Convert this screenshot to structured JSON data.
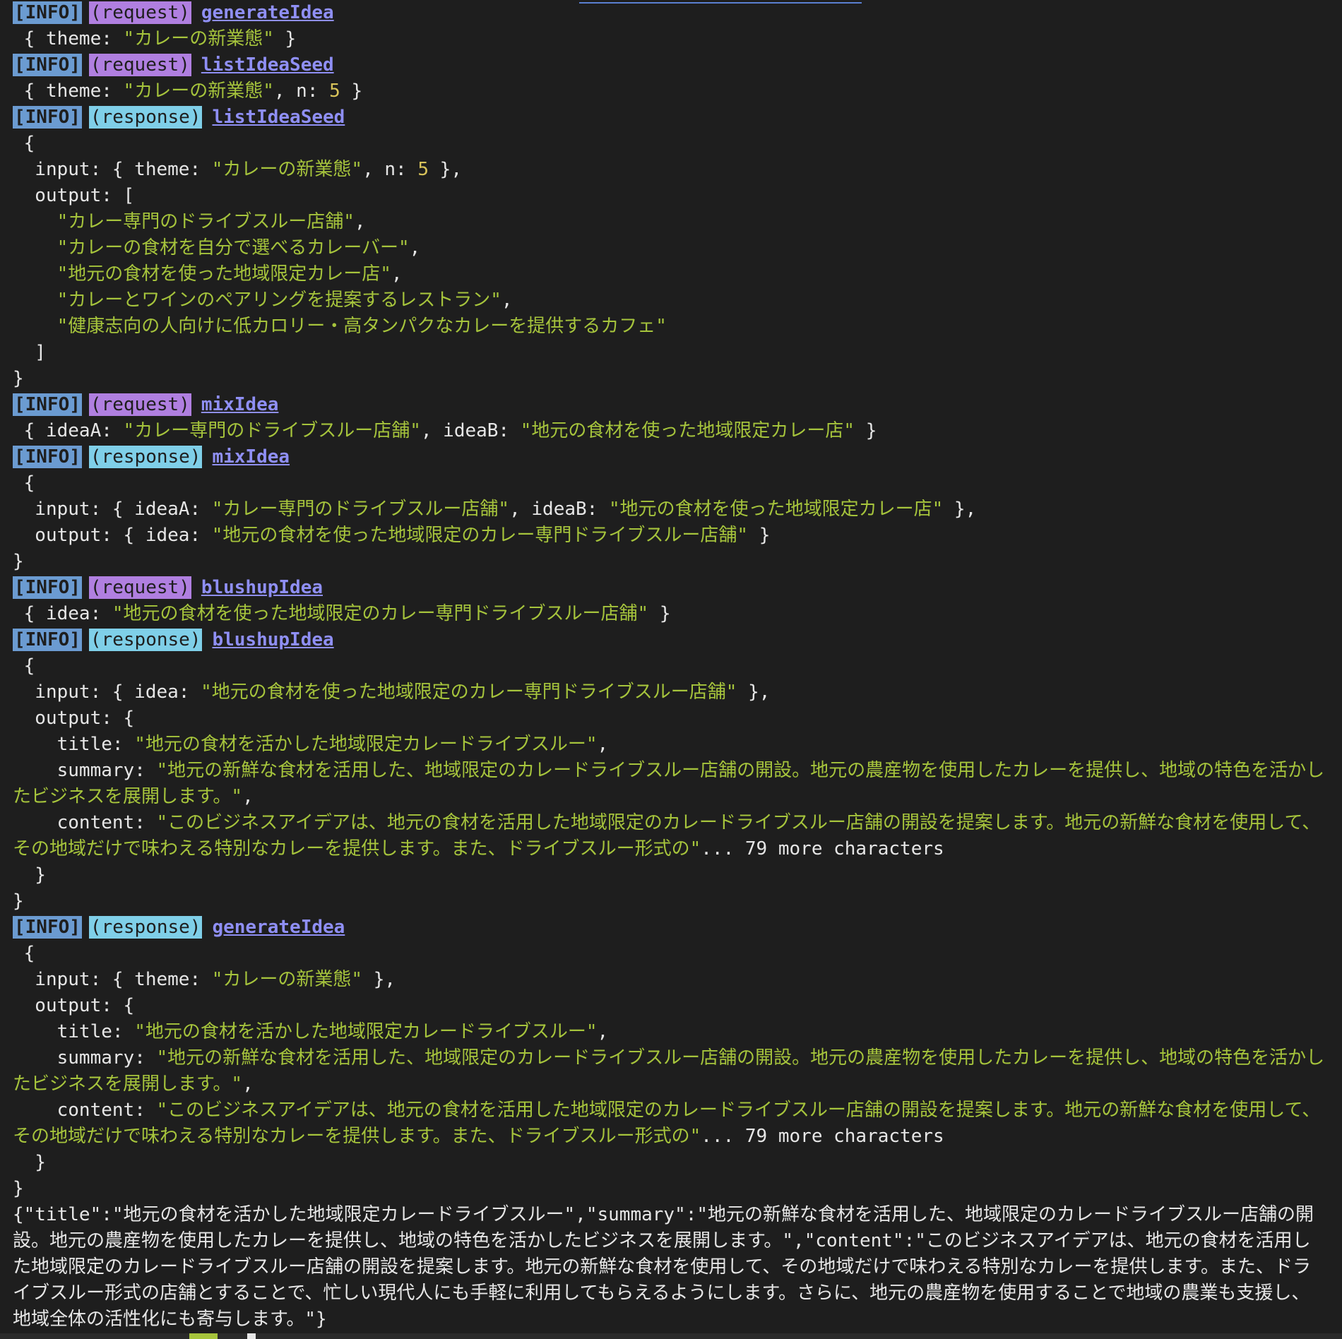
{
  "colors": {
    "background": "#1e1e1e",
    "info_tag": "#6b9bd1",
    "request_tag": "#b07fe0",
    "response_tag": "#7fcfe8",
    "function_name": "#8f8ff5",
    "string": "#a6c43c",
    "number": "#d8c35a"
  },
  "tags": {
    "info": "[INFO]",
    "request": "(request)",
    "response": "(response)"
  },
  "log": {
    "l1_fn": "generateIdea",
    "l2_a": " { theme: ",
    "l2_s": "\"カレーの新業態\"",
    "l2_b": " }",
    "l3_fn": "listIdeaSeed",
    "l4_a": " { theme: ",
    "l4_s": "\"カレーの新業態\"",
    "l4_b": ", n: ",
    "l4_n": "5",
    "l4_c": " }",
    "l5_fn": "listIdeaSeed",
    "l6": " {",
    "l7_a": "  input: { theme: ",
    "l7_s": "\"カレーの新業態\"",
    "l7_b": ", n: ",
    "l7_n": "5",
    "l7_c": " },",
    "l8": "  output: [",
    "l9_s": "    \"カレー専門のドライブスルー店舗\"",
    "l9_b": ",",
    "l10_s": "    \"カレーの食材を自分で選べるカレーバー\"",
    "l10_b": ",",
    "l11_s": "    \"地元の食材を使った地域限定カレー店\"",
    "l11_b": ",",
    "l12_s": "    \"カレーとワインのペアリングを提案するレストラン\"",
    "l12_b": ",",
    "l13_s": "    \"健康志向の人向けに低カロリー・高タンパクなカレーを提供するカフェ\"",
    "l14": "  ]",
    "l15": "}",
    "l16_fn": "mixIdea",
    "l17_a": " { ideaA: ",
    "l17_s1": "\"カレー専門のドライブスルー店舗\"",
    "l17_b": ", ideaB: ",
    "l17_s2": "\"地元の食材を使った地域限定カレー店\"",
    "l17_c": " }",
    "l18_fn": "mixIdea",
    "l19": " {",
    "l20_a": "  input: { ideaA: ",
    "l20_s1": "\"カレー専門のドライブスルー店舗\"",
    "l20_b": ", ideaB: ",
    "l20_s2": "\"地元の食材を使った地域限定カレー店\"",
    "l20_c": " },",
    "l21_a": "  output: { idea: ",
    "l21_s": "\"地元の食材を使った地域限定のカレー専門ドライブスルー店舗\"",
    "l21_c": " }",
    "l22": "}",
    "l23_fn": "blushupIdea",
    "l24_a": " { idea: ",
    "l24_s": "\"地元の食材を使った地域限定のカレー専門ドライブスルー店舗\"",
    "l24_c": " }",
    "l25_fn": "blushupIdea",
    "l26": " {",
    "l27_a": "  input: { idea: ",
    "l27_s": "\"地元の食材を使った地域限定のカレー専門ドライブスルー店舗\"",
    "l27_c": " },",
    "l28": "  output: {",
    "l29_a": "    title: ",
    "l29_s": "\"地元の食材を活かした地域限定カレードライブスルー\"",
    "l29_c": ",",
    "l30_a": "    summary: ",
    "l30_s": "\"地元の新鮮な食材を活用した、地域限定のカレードライブスルー店舗の開設。地元の農産物を使用したカレーを提供し、地域の特色を活かしたビジネスを展開します。\"",
    "l30_c": ",",
    "l31_a": "    content: ",
    "l31_s": "\"このビジネスアイデアは、地元の食材を活用した地域限定のカレードライブスルー店舗の開設を提案します。地元の新鮮な食材を使用して、その地域だけで味わえる特別なカレーを提供します。また、ドライブスルー形式の\"",
    "l31_c": "... 79 more characters",
    "l32": "  }",
    "l33": "}",
    "l34_fn": "generateIdea",
    "l35": " {",
    "l36_a": "  input: { theme: ",
    "l36_s": "\"カレーの新業態\"",
    "l36_c": " },",
    "l37": "  output: {",
    "l38_a": "    title: ",
    "l38_s": "\"地元の食材を活かした地域限定カレードライブスルー\"",
    "l38_c": ",",
    "l39_a": "    summary: ",
    "l39_s": "\"地元の新鮮な食材を活用した、地域限定のカレードライブスルー店舗の開設。地元の農産物を使用したカレーを提供し、地域の特色を活かしたビジネスを展開します。\"",
    "l39_c": ",",
    "l40_a": "    content: ",
    "l40_s": "\"このビジネスアイデアは、地元の食材を活用した地域限定のカレードライブスルー店舗の開設を提案します。地元の新鮮な食材を使用して、その地域だけで味わえる特別なカレーを提供します。また、ドライブスルー形式の\"",
    "l40_c": "... 79 more characters",
    "l41": "  }",
    "l42": "}",
    "l43": "{\"title\":\"地元の食材を活かした地域限定カレードライブスルー\",\"summary\":\"地元の新鮮な食材を活用した、地域限定のカレードライブスルー店舗の開設。地元の農産物を使用したカレーを提供し、地域の特色を活かしたビジネスを展開します。\",\"content\":\"このビジネスアイデアは、地元の食材を活用した地域限定のカレードライブスルー店舗の開設を提案します。地元の新鮮な食材を使用して、その地域だけで味わえる特別なカレーを提供します。また、ドライブスルー形式の店舗とすることで、忙しい現代人にも手軽に利用してもらえるようにします。さらに、地元の農産物を使用することで地域の農業も支援し、地域全体の活性化にも寄与します。\"}"
  }
}
